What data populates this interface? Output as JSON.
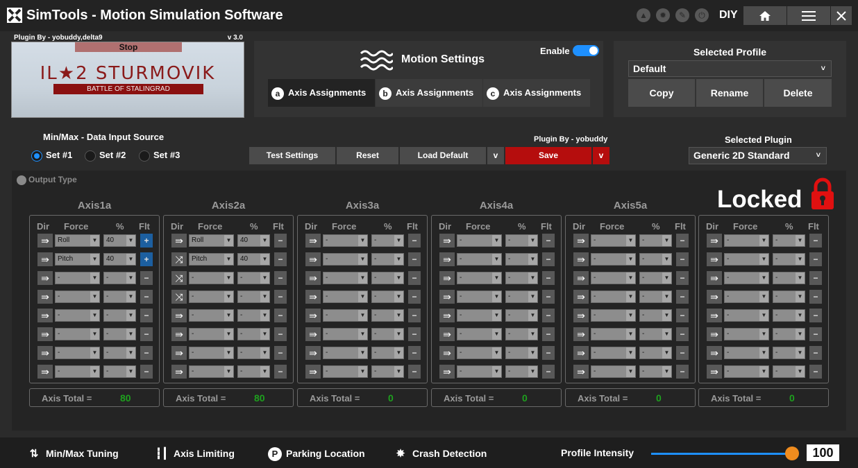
{
  "titlebar": {
    "title": "SimTools - Motion Simulation Software",
    "mode": "DIY",
    "home_icon": "home-icon",
    "menu_icon": "menu-icon",
    "close_icon": "close-icon"
  },
  "plugin_preview": {
    "plugin_by": "Plugin By - yobuddy,delta9",
    "version": "v 3.0",
    "stop_label": "Stop",
    "game_title": "IL★2 STURMOVIK",
    "game_subtitle": "BATTLE OF STALINGRAD"
  },
  "motion_settings": {
    "title": "Motion Settings",
    "enable_label": "Enable",
    "enabled": true,
    "tabs": [
      {
        "badge": "a",
        "label": "Axis Assignments",
        "active": true
      },
      {
        "badge": "b",
        "label": "Axis Assignments",
        "active": false
      },
      {
        "badge": "c",
        "label": "Axis Assignments",
        "active": false
      }
    ]
  },
  "profile": {
    "title": "Selected Profile",
    "selected": "Default",
    "arrow": "˅",
    "buttons": [
      "Copy",
      "Rename",
      "Delete"
    ]
  },
  "data_source": {
    "label": "Min/Max - Data Input Source",
    "sets": [
      "Set #1",
      "Set #2",
      "Set #3"
    ],
    "selected_index": 0
  },
  "actions": {
    "test": "Test Settings",
    "reset": "Reset",
    "load_default": "Load Default",
    "dropdown": "v",
    "save": "Save",
    "save_dropdown": "v",
    "plugin_by": "Plugin By - yobuddy"
  },
  "selected_plugin": {
    "label": "Selected Plugin",
    "value": "Generic 2D Standard",
    "arrow": "˅"
  },
  "output": {
    "output_type_label": "Output Type",
    "locked_label": "Locked",
    "headers": {
      "dir": "Dir",
      "force": "Force",
      "pct": "%",
      "flt": "Flt"
    },
    "total_label": "Axis Total =",
    "axes": [
      {
        "name": "Axis1a",
        "total": "80",
        "rows": [
          {
            "dir": "arrow",
            "force": "Roll",
            "pct": "40",
            "flt": "+"
          },
          {
            "dir": "arrow",
            "force": "Pitch",
            "pct": "40",
            "flt": "+"
          },
          {
            "dir": "arrow",
            "force": "-",
            "pct": "-",
            "flt": "−"
          },
          {
            "dir": "arrow",
            "force": "-",
            "pct": "-",
            "flt": "−"
          },
          {
            "dir": "arrow",
            "force": "-",
            "pct": "-",
            "flt": "−"
          },
          {
            "dir": "arrow",
            "force": "-",
            "pct": "-",
            "flt": "−"
          },
          {
            "dir": "arrow",
            "force": "-",
            "pct": "-",
            "flt": "−"
          },
          {
            "dir": "arrow",
            "force": "-",
            "pct": "-",
            "flt": "−"
          }
        ]
      },
      {
        "name": "Axis2a",
        "total": "80",
        "rows": [
          {
            "dir": "arrow",
            "force": "Roll",
            "pct": "40",
            "flt": "−"
          },
          {
            "dir": "shuffle",
            "force": "Pitch",
            "pct": "40",
            "flt": "−"
          },
          {
            "dir": "shuffle",
            "force": "-",
            "pct": "-",
            "flt": "−"
          },
          {
            "dir": "shuffle",
            "force": "-",
            "pct": "-",
            "flt": "−"
          },
          {
            "dir": "arrow",
            "force": "-",
            "pct": "-",
            "flt": "−"
          },
          {
            "dir": "arrow",
            "force": "-",
            "pct": "-",
            "flt": "−"
          },
          {
            "dir": "arrow",
            "force": "-",
            "pct": "-",
            "flt": "−"
          },
          {
            "dir": "arrow",
            "force": "-",
            "pct": "-",
            "flt": "−"
          }
        ]
      },
      {
        "name": "Axis3a",
        "total": "0",
        "rows": [
          {
            "dir": "arrow",
            "force": "-",
            "pct": "-",
            "flt": "−"
          },
          {
            "dir": "arrow",
            "force": "-",
            "pct": "-",
            "flt": "−"
          },
          {
            "dir": "arrow",
            "force": "-",
            "pct": "-",
            "flt": "−"
          },
          {
            "dir": "arrow",
            "force": "-",
            "pct": "-",
            "flt": "−"
          },
          {
            "dir": "arrow",
            "force": "-",
            "pct": "-",
            "flt": "−"
          },
          {
            "dir": "arrow",
            "force": "-",
            "pct": "-",
            "flt": "−"
          },
          {
            "dir": "arrow",
            "force": "-",
            "pct": "-",
            "flt": "−"
          },
          {
            "dir": "arrow",
            "force": "-",
            "pct": "-",
            "flt": "−"
          }
        ]
      },
      {
        "name": "Axis4a",
        "total": "0",
        "rows": [
          {
            "dir": "arrow",
            "force": "-",
            "pct": "-",
            "flt": "−"
          },
          {
            "dir": "arrow",
            "force": "-",
            "pct": "-",
            "flt": "−"
          },
          {
            "dir": "arrow",
            "force": "-",
            "pct": "-",
            "flt": "−"
          },
          {
            "dir": "arrow",
            "force": "-",
            "pct": "-",
            "flt": "−"
          },
          {
            "dir": "arrow",
            "force": "-",
            "pct": "-",
            "flt": "−"
          },
          {
            "dir": "arrow",
            "force": "-",
            "pct": "-",
            "flt": "−"
          },
          {
            "dir": "arrow",
            "force": "-",
            "pct": "-",
            "flt": "−"
          },
          {
            "dir": "arrow",
            "force": "-",
            "pct": "-",
            "flt": "−"
          }
        ]
      },
      {
        "name": "Axis5a",
        "total": "0",
        "rows": [
          {
            "dir": "arrow",
            "force": "-",
            "pct": "-",
            "flt": "−"
          },
          {
            "dir": "arrow",
            "force": "-",
            "pct": "-",
            "flt": "−"
          },
          {
            "dir": "arrow",
            "force": "-",
            "pct": "-",
            "flt": "−"
          },
          {
            "dir": "arrow",
            "force": "-",
            "pct": "-",
            "flt": "−"
          },
          {
            "dir": "arrow",
            "force": "-",
            "pct": "-",
            "flt": "−"
          },
          {
            "dir": "arrow",
            "force": "-",
            "pct": "-",
            "flt": "−"
          },
          {
            "dir": "arrow",
            "force": "-",
            "pct": "-",
            "flt": "−"
          },
          {
            "dir": "arrow",
            "force": "-",
            "pct": "-",
            "flt": "−"
          }
        ]
      },
      {
        "name": "",
        "total": "0",
        "rows": [
          {
            "dir": "arrow",
            "force": "-",
            "pct": "-",
            "flt": "−"
          },
          {
            "dir": "arrow",
            "force": "-",
            "pct": "-",
            "flt": "−"
          },
          {
            "dir": "arrow",
            "force": "-",
            "pct": "-",
            "flt": "−"
          },
          {
            "dir": "arrow",
            "force": "-",
            "pct": "-",
            "flt": "−"
          },
          {
            "dir": "arrow",
            "force": "-",
            "pct": "-",
            "flt": "−"
          },
          {
            "dir": "arrow",
            "force": "-",
            "pct": "-",
            "flt": "−"
          },
          {
            "dir": "arrow",
            "force": "-",
            "pct": "-",
            "flt": "−"
          },
          {
            "dir": "arrow",
            "force": "-",
            "pct": "-",
            "flt": "−"
          }
        ]
      }
    ]
  },
  "bottom": {
    "items": [
      {
        "icon": "minmax-tuning-icon",
        "label": "Min/Max Tuning"
      },
      {
        "icon": "axis-limiting-icon",
        "label": "Axis Limiting"
      },
      {
        "icon": "parking-icon",
        "label": "Parking Location"
      },
      {
        "icon": "crash-icon",
        "label": "Crash Detection"
      }
    ],
    "intensity_label": "Profile Intensity",
    "intensity_value": "100"
  },
  "colors": {
    "accent": "#1e90ff",
    "save": "#b50d0d",
    "total_green": "#1ea01e",
    "slider_thumb": "#f08c1e",
    "locked_red": "#e01010"
  }
}
